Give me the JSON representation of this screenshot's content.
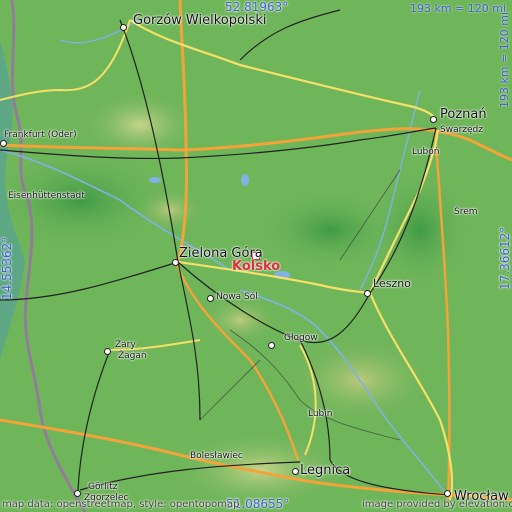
{
  "map": {
    "center_town": "Kolsko",
    "coords": {
      "top_lat": "52.81963°",
      "bottom_lat": "51.08655°",
      "left_lon": "14.55362°",
      "right_lon": "17.36612°"
    },
    "scale": {
      "top": "193 km = 120 mi",
      "right": "193 km = 120 mi"
    },
    "footer": {
      "left": "map data: openstreetmap, style: opentopomap",
      "right": "image provided by elevation.city"
    },
    "cities": [
      {
        "name": "Gorzów Wielkopolski",
        "size": "big"
      },
      {
        "name": "Poznań",
        "size": "big"
      },
      {
        "name": "Swarzędz",
        "size": "sm"
      },
      {
        "name": "Luboń",
        "size": "sm"
      },
      {
        "name": "Frankfurt (Oder)",
        "size": "sm"
      },
      {
        "name": "Eisenhüttenstadt",
        "size": "sm"
      },
      {
        "name": "Śrem",
        "size": "sm"
      },
      {
        "name": "Zielona Góra",
        "size": "big"
      },
      {
        "name": "Leszno",
        "size": "med"
      },
      {
        "name": "Nowa Sól",
        "size": "sm"
      },
      {
        "name": "Żary",
        "size": "sm"
      },
      {
        "name": "Żagań",
        "size": "sm"
      },
      {
        "name": "Głogów",
        "size": "sm"
      },
      {
        "name": "Lubin",
        "size": "sm"
      },
      {
        "name": "Bolesławiec",
        "size": "sm"
      },
      {
        "name": "Legnica",
        "size": "big"
      },
      {
        "name": "Görlitz",
        "size": "sm"
      },
      {
        "name": "Zgorzelec",
        "size": "sm"
      },
      {
        "name": "Wrocław",
        "size": "big"
      }
    ],
    "colors": {
      "land": "#6fb55a",
      "highway": "#f2a43a",
      "road": "#f6e06a",
      "rail": "#222222",
      "water": "#7fb2e5",
      "border": "#9b6fa8",
      "label_accent": "#3d5fd6",
      "focus": "#e0303a"
    }
  }
}
